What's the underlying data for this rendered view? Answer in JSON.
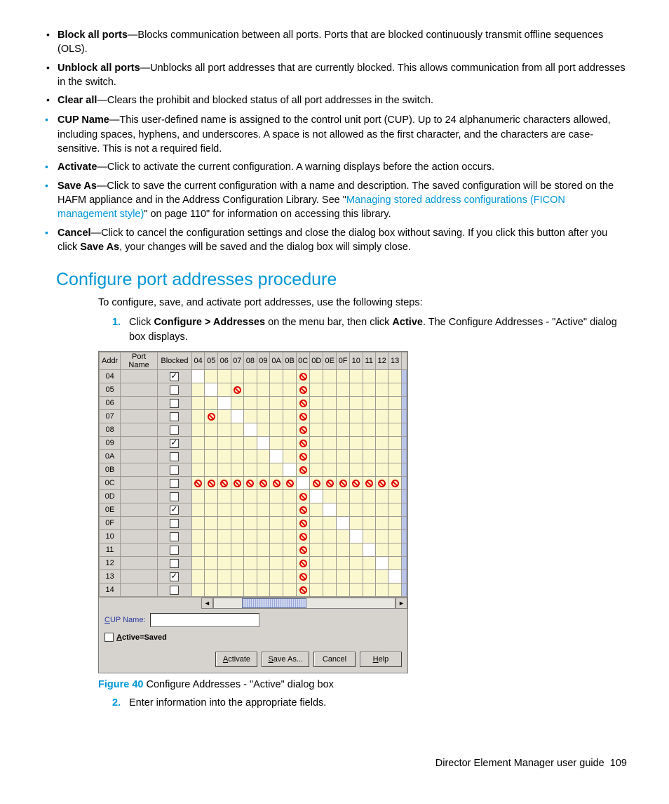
{
  "bullets_inner": [
    {
      "term": "Block all ports",
      "text": "—Blocks communication between all ports. Ports that are blocked continuously transmit offline sequences (OLS)."
    },
    {
      "term": "Unblock all ports",
      "text": "—Unblocks all port addresses that are currently blocked. This allows communication from all port addresses in the switch."
    },
    {
      "term": "Clear all",
      "text": "—Clears the prohibit and blocked status of all port addresses in the switch."
    }
  ],
  "bullets_outer": [
    {
      "term": "CUP Name",
      "text": "—This user-defined name is assigned to the control unit port (CUP). Up to 24 alphanumeric characters allowed, including spaces, hyphens, and underscores. A space is not allowed as the first character, and the characters are case-sensitive. This is not a required field."
    },
    {
      "term": "Activate",
      "text": "—Click to activate the current configuration. A warning displays before the action occurs."
    },
    {
      "term": "Save As",
      "pre": "—Click to save the current configuration with a name and description. The saved configuration will be stored on the HAFM appliance and in the Address Configuration Library. See \"",
      "link": "Managing stored address configurations (FICON management style)",
      "post": "\" on page 110\" for information on accessing this library."
    },
    {
      "term": "Cancel",
      "pre": "—Click to cancel the configuration settings and close the dialog box without saving. If you click this button after you click ",
      "bold": "Save As",
      "post": ", your changes will be saved and the dialog box will simply close."
    }
  ],
  "heading": "Configure port addresses procedure",
  "intro": "To configure, save, and activate port addresses, use the following steps:",
  "step1": {
    "num": "1.",
    "pre": "Click ",
    "b1": "Configure > Addresses",
    "mid": " on the menu bar, then click ",
    "b2": "Active",
    "post": ". The Configure Addresses - \"Active\" dialog box displays."
  },
  "step2": {
    "num": "2.",
    "text": "Enter information into the appropriate fields."
  },
  "dialog": {
    "headers": {
      "addr": "Addr",
      "pname": "Port Name",
      "blocked": "Blocked",
      "cols": [
        "04",
        "05",
        "06",
        "07",
        "08",
        "09",
        "0A",
        "0B",
        "0C",
        "0D",
        "0E",
        "0F",
        "10",
        "11",
        "12",
        "13"
      ]
    },
    "rows": [
      {
        "addr": "04",
        "blocked": true,
        "prohibit": [
          "0C"
        ]
      },
      {
        "addr": "05",
        "blocked": false,
        "prohibit": [
          "07",
          "0C"
        ]
      },
      {
        "addr": "06",
        "blocked": false,
        "prohibit": [
          "0C"
        ]
      },
      {
        "addr": "07",
        "blocked": false,
        "prohibit": [
          "05",
          "0C"
        ]
      },
      {
        "addr": "08",
        "blocked": false,
        "prohibit": [
          "0C"
        ]
      },
      {
        "addr": "09",
        "blocked": true,
        "prohibit": [
          "0C"
        ]
      },
      {
        "addr": "0A",
        "blocked": false,
        "prohibit": [
          "0C"
        ]
      },
      {
        "addr": "0B",
        "blocked": false,
        "prohibit": [
          "0C"
        ]
      },
      {
        "addr": "0C",
        "blocked": false,
        "prohibit": [
          "04",
          "05",
          "06",
          "07",
          "08",
          "09",
          "0A",
          "0B",
          "0D",
          "0E",
          "0F",
          "10",
          "11",
          "12",
          "13"
        ]
      },
      {
        "addr": "0D",
        "blocked": false,
        "prohibit": [
          "0C"
        ]
      },
      {
        "addr": "0E",
        "blocked": true,
        "prohibit": [
          "0C"
        ]
      },
      {
        "addr": "0F",
        "blocked": false,
        "prohibit": [
          "0C"
        ]
      },
      {
        "addr": "10",
        "blocked": false,
        "prohibit": [
          "0C"
        ]
      },
      {
        "addr": "11",
        "blocked": false,
        "prohibit": [
          "0C"
        ]
      },
      {
        "addr": "12",
        "blocked": false,
        "prohibit": [
          "0C"
        ]
      },
      {
        "addr": "13",
        "blocked": true,
        "prohibit": [
          "0C"
        ]
      },
      {
        "addr": "14",
        "blocked": false,
        "prohibit": [
          "0C"
        ]
      }
    ],
    "cup_label": "CUP Name:",
    "cup_underline": "C",
    "cup_value": "",
    "active_saved": "Active=Saved",
    "active_underline": "A",
    "buttons": {
      "activate": "Activate",
      "activate_u": "A",
      "saveas": "Save As...",
      "saveas_u": "S",
      "cancel": "Cancel",
      "help": "Help",
      "help_u": "H"
    }
  },
  "caption": {
    "label": "Figure 40",
    "text": " Configure Addresses - \"Active\" dialog box"
  },
  "footer": {
    "text": "Director Element Manager user guide",
    "page": "109"
  }
}
